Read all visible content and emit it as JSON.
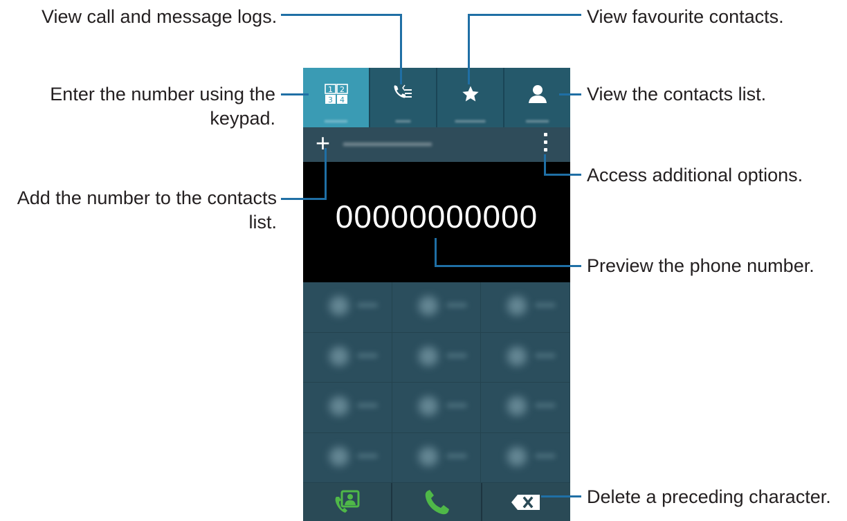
{
  "annotations": {
    "logs": "View call and message logs.",
    "favourites": "View favourite contacts.",
    "keypad_line1": "Enter the number using the",
    "keypad_line2": "keypad.",
    "contacts_list": "View the contacts list.",
    "options": "Access additional options.",
    "add_line1": "Add the number to the contacts",
    "add_line2": "list.",
    "preview": "Preview the phone number.",
    "delete": "Delete a preceding character."
  },
  "phone": {
    "tabs": [
      {
        "icon": "keypad-icon",
        "active": true
      },
      {
        "icon": "call-logs-icon",
        "active": false
      },
      {
        "icon": "star-icon",
        "active": false
      },
      {
        "icon": "contact-icon",
        "active": false
      }
    ],
    "action_bar": {
      "add_icon": "plus-icon",
      "more_icon": "more-vertical-icon"
    },
    "display": {
      "number": "00000000000"
    },
    "bottom_bar": [
      {
        "icon": "contact-card-call-icon"
      },
      {
        "icon": "phone-icon"
      },
      {
        "icon": "backspace-icon"
      }
    ]
  },
  "colors": {
    "annotation_line": "#1f6fa5",
    "tab_active": "#3a9bb4",
    "tab_bar": "#25596b",
    "display_bg": "#000000",
    "call_green": "#4fb848"
  }
}
